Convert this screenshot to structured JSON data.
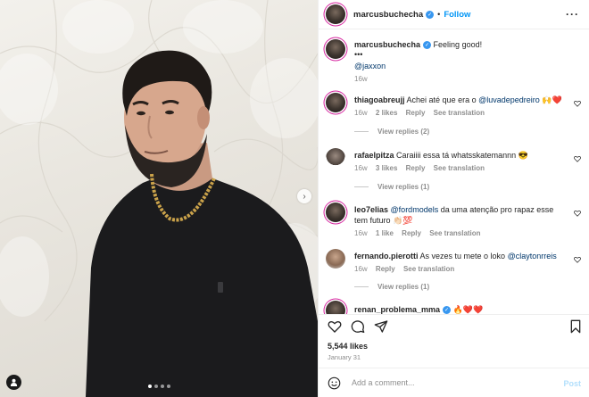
{
  "post": {
    "username": "marcusbuchecha",
    "follow_label": "Follow",
    "separator": "•",
    "more_icon": "more-horizontal-icon",
    "caption": {
      "text": "Feeling good!",
      "dots": "•••",
      "mention": "@jaxxon",
      "time": "16w"
    },
    "carousel": {
      "dot_count": 4,
      "active_index": 0
    }
  },
  "comments": [
    {
      "user": "thiagoabreujj",
      "pre": "Achei até que era o ",
      "mention": "@luvadepedreiro",
      "post": " 🙌❤️",
      "time": "16w",
      "likes": "2 likes",
      "reply": "Reply",
      "translate": "See translation",
      "replies": "View replies (2)"
    },
    {
      "user": "rafaelpitza",
      "pre": "Caraiiii essa tá whatsskatemannn 😎",
      "mention": "",
      "post": "",
      "time": "16w",
      "likes": "3 likes",
      "reply": "Reply",
      "translate": "See translation",
      "replies": "View replies (1)"
    },
    {
      "user": "leo7elias",
      "pre": "",
      "mention": "@fordmodels",
      "post": " da uma atenção pro rapaz esse tem futuro 👏🏻💯",
      "time": "16w",
      "likes": "1 like",
      "reply": "Reply",
      "translate": "See translation",
      "replies": "View replies (1)"
    },
    {
      "user": "fernando.pierotti",
      "pre": "As vezes tu mete o loko ",
      "mention": "@claytonrreis",
      "post": "",
      "time": "16w",
      "likes": "",
      "reply": "Reply",
      "translate": "See translation",
      "replies": "View replies (1)"
    },
    {
      "user": "renan_problema_mma",
      "pre": " 🔥❤️❤️",
      "mention": "",
      "post": "",
      "time": "",
      "likes": "",
      "reply": "",
      "translate": "",
      "replies": ""
    }
  ],
  "actions": {
    "likes": "5,544 likes",
    "date": "January 31"
  },
  "composer": {
    "placeholder": "Add a comment...",
    "post_label": "Post"
  },
  "colors": {
    "link": "#0095f6",
    "mention": "#00376b",
    "muted": "#8e8e8e",
    "story_ring": "#d6249f",
    "verified": "#3897f0"
  }
}
